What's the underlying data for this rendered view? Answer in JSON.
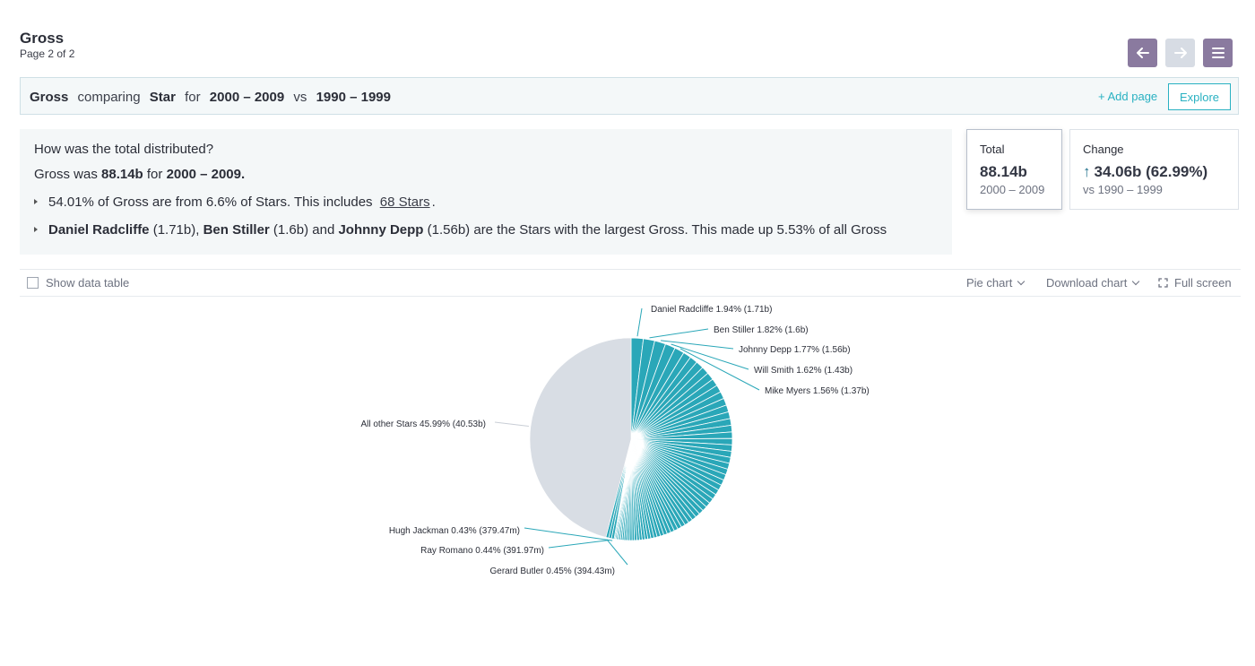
{
  "header": {
    "title": "Gross",
    "subtitle": "Page 2 of 2"
  },
  "nav": {
    "prev_icon": "arrow-left-icon",
    "next_icon": "arrow-right-icon",
    "menu_icon": "hamburger-menu-icon"
  },
  "query": {
    "measure": "Gross",
    "word_comparing": "comparing",
    "dimension": "Star",
    "word_for": "for",
    "period": "2000 – 2009",
    "word_vs": "vs",
    "compare_period": "1990 – 1999",
    "add_page_label": "+ Add page",
    "explore_label": "Explore"
  },
  "insight": {
    "question": "How was the total distributed?",
    "line_prefix": "Gross was ",
    "line_value": "88.14b",
    "line_mid": " for ",
    "line_period": "2000 – 2009.",
    "bullet1_text": "54.01% of Gross are from 6.6% of Stars. This includes",
    "bullet1_link": "68 Stars",
    "bullet1_end": ".",
    "bullet2": {
      "name1": "Daniel Radcliffe",
      "val1": " (1.71b), ",
      "name2": "Ben Stiller",
      "val2": " (1.6b) and ",
      "name3": "Johnny Depp",
      "val3": " (1.56b) are the Stars with the largest Gross. This made up 5.53% of all Gross"
    }
  },
  "cards": {
    "total": {
      "label": "Total",
      "value": "88.14b",
      "sub": "2000 – 2009"
    },
    "change": {
      "label": "Change",
      "arrow": "↑",
      "value": "34.06b (62.99%)",
      "sub": "vs 1990 – 1999"
    }
  },
  "toolbar": {
    "show_data_table": "Show data table",
    "chart_type": "Pie chart",
    "download": "Download chart",
    "full_screen": "Full screen"
  },
  "colors": {
    "accent": "#29b1c2",
    "slice": "#2aa7b8",
    "other": "#d8dde4",
    "nav": "#8a7a9f"
  },
  "chart_data": {
    "type": "pie",
    "labeled_slices": [
      {
        "name": "Daniel Radcliffe",
        "percent": 1.94,
        "value_label": "1.71b"
      },
      {
        "name": "Ben Stiller",
        "percent": 1.82,
        "value_label": "1.6b"
      },
      {
        "name": "Johnny Depp",
        "percent": 1.77,
        "value_label": "1.56b"
      },
      {
        "name": "Will Smith",
        "percent": 1.62,
        "value_label": "1.43b"
      },
      {
        "name": "Mike Myers",
        "percent": 1.56,
        "value_label": "1.37b"
      },
      {
        "name": "Gerard Butler",
        "percent": 0.45,
        "value_label": "394.43m"
      },
      {
        "name": "Ray Romano",
        "percent": 0.44,
        "value_label": "391.97m"
      },
      {
        "name": "Hugh Jackman",
        "percent": 0.43,
        "value_label": "379.47m"
      }
    ],
    "other": {
      "name": "All other Stars",
      "percent": 45.99,
      "value_label": "40.53b"
    },
    "slice_count": 69
  }
}
